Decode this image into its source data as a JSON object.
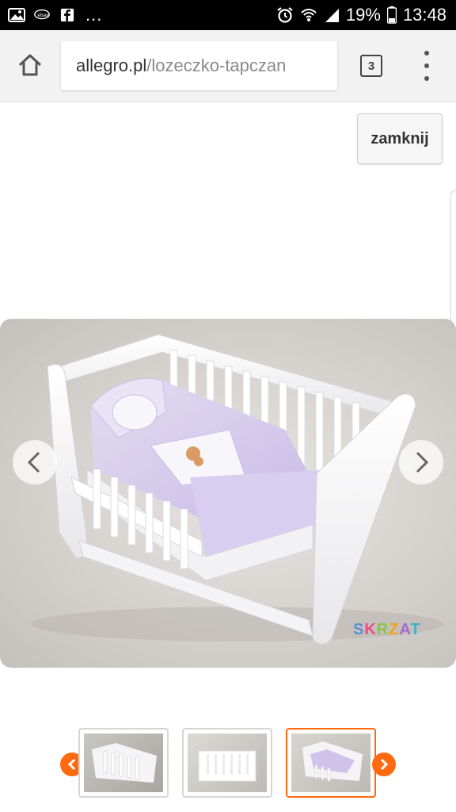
{
  "status_bar": {
    "battery": "19%",
    "time": "13:48",
    "overflow": "..."
  },
  "browser": {
    "url_domain": "allegro.pl",
    "url_path": "/lozeczko-tapczan",
    "tab_count": "3"
  },
  "gallery": {
    "close_label": "zamknij",
    "brand_name": "SKRZAT",
    "brand_colors": [
      "#5b8fd6",
      "#e84c89",
      "#8bc34a",
      "#f3a21b",
      "#a46bd1",
      "#3fb2c7"
    ],
    "thumbnails": [
      {
        "label": "crib-white-front"
      },
      {
        "label": "crib-white-side"
      },
      {
        "label": "crib-with-bedding",
        "active": true
      }
    ],
    "accent_color": "#ff6a10"
  }
}
